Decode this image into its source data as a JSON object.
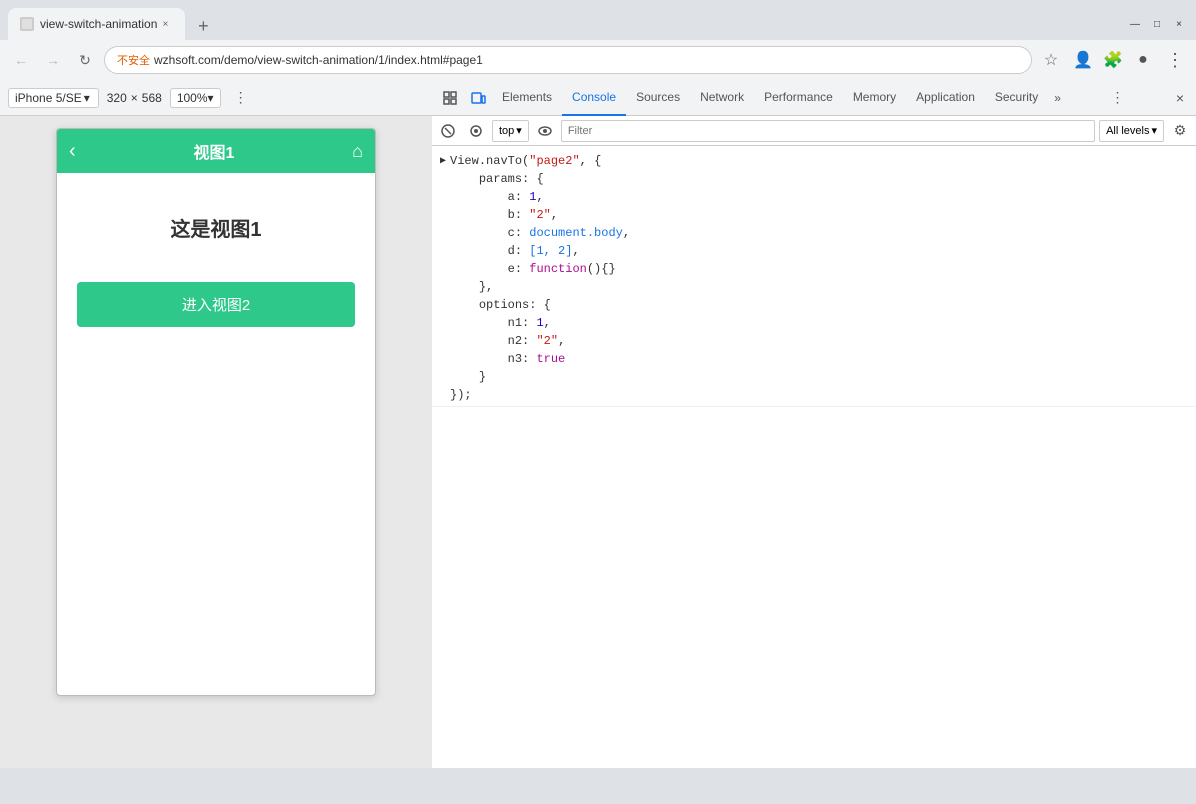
{
  "browser": {
    "tab_title": "view-switch-animation",
    "tab_close": "×",
    "tab_new": "+",
    "url": "wzhsoft.com/demo/view-switch-animation/1/index.html#page1",
    "url_full": "不安全",
    "nav_back": "←",
    "nav_forward": "→",
    "nav_refresh": "↻",
    "bookmark": "☆",
    "menu_more": "⋮",
    "window_minimize": "—",
    "window_maximize": "□",
    "window_close": "×"
  },
  "device_toolbar": {
    "device_name": "iPhone 5/SE",
    "chevron": "▾",
    "rotate": "⇄",
    "width": "320",
    "x": "×",
    "height": "568",
    "zoom": "100%",
    "zoom_chevron": "▾",
    "more_icon": "⋮"
  },
  "phone": {
    "back_btn": "‹",
    "title": "视图1",
    "home_btn": "⌂",
    "view_label": "这是视图1",
    "nav_button": "进入视图2"
  },
  "devtools": {
    "tabs": [
      {
        "label": "Elements",
        "id": "elements"
      },
      {
        "label": "Console",
        "id": "console",
        "active": true
      },
      {
        "label": "Sources",
        "id": "sources"
      },
      {
        "label": "Network",
        "id": "network"
      },
      {
        "label": "Performance",
        "id": "performance"
      },
      {
        "label": "Memory",
        "id": "memory"
      },
      {
        "label": "Application",
        "id": "application"
      },
      {
        "label": "Security",
        "id": "security"
      }
    ],
    "more_tabs": "»",
    "panel_menu": "⋮",
    "panel_close": "×",
    "inspect_icon": "⬚",
    "device_icon": "□",
    "console_toolbar": {
      "clear": "🚫",
      "preserve": "⊙",
      "top": "top",
      "chevron": "▾",
      "eye": "👁",
      "filter_placeholder": "Filter",
      "level": "All levels",
      "level_chevron": "▾",
      "settings": "⚙"
    },
    "console_output": {
      "arrow": "▶",
      "lines": [
        {
          "text": "View.navTo(\"page2\", {",
          "indent": 0
        },
        {
          "text": "    params: {",
          "indent": 1
        },
        {
          "text": "        a: 1,",
          "indent": 2,
          "key": "a",
          "value_number": "1"
        },
        {
          "text": "        b: \"2\",",
          "indent": 2,
          "key": "b",
          "value_string": "\"2\""
        },
        {
          "text": "        c: document.body,",
          "indent": 2,
          "key": "c",
          "value_blue": "document.body"
        },
        {
          "text": "        d: [1, 2],",
          "indent": 2,
          "key": "d",
          "value_blue": "[1, 2]"
        },
        {
          "text": "        e: function(){}",
          "indent": 2,
          "key": "e",
          "value_keyword": "function(){}"
        },
        {
          "text": "    },",
          "indent": 1
        },
        {
          "text": "    options: {",
          "indent": 1
        },
        {
          "text": "        n1: 1,",
          "indent": 2,
          "key": "n1",
          "value_number": "1"
        },
        {
          "text": "        n2: \"2\",",
          "indent": 2,
          "key": "n2",
          "value_string": "\"2\""
        },
        {
          "text": "        n3: true",
          "indent": 2,
          "key": "n3",
          "value_keyword": "true"
        },
        {
          "text": "    }",
          "indent": 1
        },
        {
          "text": "});",
          "indent": 0
        }
      ]
    }
  },
  "colors": {
    "green": "#2DC88A",
    "active_tab": "#1a73e8",
    "string_color": "#c41a16",
    "number_color": "#1c00cf",
    "keyword_color": "#aa0d91",
    "blue_color": "#1a73e8"
  }
}
